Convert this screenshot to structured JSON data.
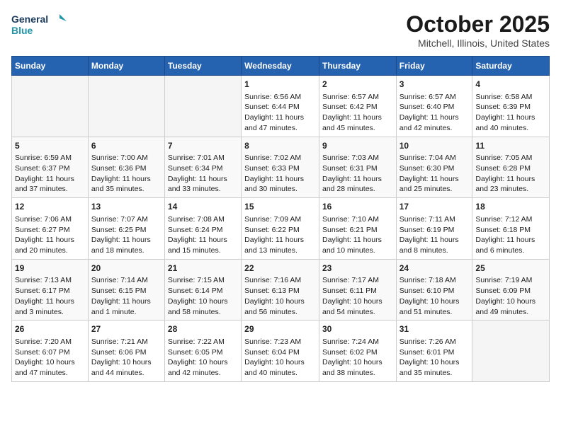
{
  "header": {
    "logo_line1": "General",
    "logo_line2": "Blue",
    "title": "October 2025",
    "subtitle": "Mitchell, Illinois, United States"
  },
  "weekdays": [
    "Sunday",
    "Monday",
    "Tuesday",
    "Wednesday",
    "Thursday",
    "Friday",
    "Saturday"
  ],
  "weeks": [
    [
      {
        "day": "",
        "content": ""
      },
      {
        "day": "",
        "content": ""
      },
      {
        "day": "",
        "content": ""
      },
      {
        "day": "1",
        "content": "Sunrise: 6:56 AM\nSunset: 6:44 PM\nDaylight: 11 hours\nand 47 minutes."
      },
      {
        "day": "2",
        "content": "Sunrise: 6:57 AM\nSunset: 6:42 PM\nDaylight: 11 hours\nand 45 minutes."
      },
      {
        "day": "3",
        "content": "Sunrise: 6:57 AM\nSunset: 6:40 PM\nDaylight: 11 hours\nand 42 minutes."
      },
      {
        "day": "4",
        "content": "Sunrise: 6:58 AM\nSunset: 6:39 PM\nDaylight: 11 hours\nand 40 minutes."
      }
    ],
    [
      {
        "day": "5",
        "content": "Sunrise: 6:59 AM\nSunset: 6:37 PM\nDaylight: 11 hours\nand 37 minutes."
      },
      {
        "day": "6",
        "content": "Sunrise: 7:00 AM\nSunset: 6:36 PM\nDaylight: 11 hours\nand 35 minutes."
      },
      {
        "day": "7",
        "content": "Sunrise: 7:01 AM\nSunset: 6:34 PM\nDaylight: 11 hours\nand 33 minutes."
      },
      {
        "day": "8",
        "content": "Sunrise: 7:02 AM\nSunset: 6:33 PM\nDaylight: 11 hours\nand 30 minutes."
      },
      {
        "day": "9",
        "content": "Sunrise: 7:03 AM\nSunset: 6:31 PM\nDaylight: 11 hours\nand 28 minutes."
      },
      {
        "day": "10",
        "content": "Sunrise: 7:04 AM\nSunset: 6:30 PM\nDaylight: 11 hours\nand 25 minutes."
      },
      {
        "day": "11",
        "content": "Sunrise: 7:05 AM\nSunset: 6:28 PM\nDaylight: 11 hours\nand 23 minutes."
      }
    ],
    [
      {
        "day": "12",
        "content": "Sunrise: 7:06 AM\nSunset: 6:27 PM\nDaylight: 11 hours\nand 20 minutes."
      },
      {
        "day": "13",
        "content": "Sunrise: 7:07 AM\nSunset: 6:25 PM\nDaylight: 11 hours\nand 18 minutes."
      },
      {
        "day": "14",
        "content": "Sunrise: 7:08 AM\nSunset: 6:24 PM\nDaylight: 11 hours\nand 15 minutes."
      },
      {
        "day": "15",
        "content": "Sunrise: 7:09 AM\nSunset: 6:22 PM\nDaylight: 11 hours\nand 13 minutes."
      },
      {
        "day": "16",
        "content": "Sunrise: 7:10 AM\nSunset: 6:21 PM\nDaylight: 11 hours\nand 10 minutes."
      },
      {
        "day": "17",
        "content": "Sunrise: 7:11 AM\nSunset: 6:19 PM\nDaylight: 11 hours\nand 8 minutes."
      },
      {
        "day": "18",
        "content": "Sunrise: 7:12 AM\nSunset: 6:18 PM\nDaylight: 11 hours\nand 6 minutes."
      }
    ],
    [
      {
        "day": "19",
        "content": "Sunrise: 7:13 AM\nSunset: 6:17 PM\nDaylight: 11 hours\nand 3 minutes."
      },
      {
        "day": "20",
        "content": "Sunrise: 7:14 AM\nSunset: 6:15 PM\nDaylight: 11 hours\nand 1 minute."
      },
      {
        "day": "21",
        "content": "Sunrise: 7:15 AM\nSunset: 6:14 PM\nDaylight: 10 hours\nand 58 minutes."
      },
      {
        "day": "22",
        "content": "Sunrise: 7:16 AM\nSunset: 6:13 PM\nDaylight: 10 hours\nand 56 minutes."
      },
      {
        "day": "23",
        "content": "Sunrise: 7:17 AM\nSunset: 6:11 PM\nDaylight: 10 hours\nand 54 minutes."
      },
      {
        "day": "24",
        "content": "Sunrise: 7:18 AM\nSunset: 6:10 PM\nDaylight: 10 hours\nand 51 minutes."
      },
      {
        "day": "25",
        "content": "Sunrise: 7:19 AM\nSunset: 6:09 PM\nDaylight: 10 hours\nand 49 minutes."
      }
    ],
    [
      {
        "day": "26",
        "content": "Sunrise: 7:20 AM\nSunset: 6:07 PM\nDaylight: 10 hours\nand 47 minutes."
      },
      {
        "day": "27",
        "content": "Sunrise: 7:21 AM\nSunset: 6:06 PM\nDaylight: 10 hours\nand 44 minutes."
      },
      {
        "day": "28",
        "content": "Sunrise: 7:22 AM\nSunset: 6:05 PM\nDaylight: 10 hours\nand 42 minutes."
      },
      {
        "day": "29",
        "content": "Sunrise: 7:23 AM\nSunset: 6:04 PM\nDaylight: 10 hours\nand 40 minutes."
      },
      {
        "day": "30",
        "content": "Sunrise: 7:24 AM\nSunset: 6:02 PM\nDaylight: 10 hours\nand 38 minutes."
      },
      {
        "day": "31",
        "content": "Sunrise: 7:26 AM\nSunset: 6:01 PM\nDaylight: 10 hours\nand 35 minutes."
      },
      {
        "day": "",
        "content": ""
      }
    ]
  ]
}
